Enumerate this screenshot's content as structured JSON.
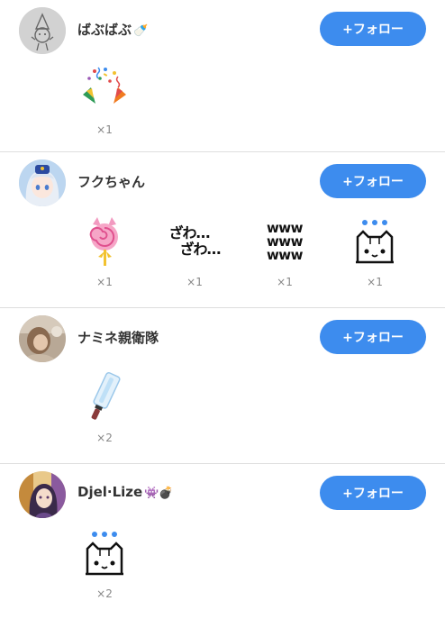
{
  "follow_label": "+フォロー",
  "users": [
    {
      "name": "ばぶばぶ",
      "name_emoji": "🍼",
      "avatar": "pencil-sketch-avatar",
      "gifts": [
        {
          "icon": "party-popper-icon",
          "count": "×1"
        }
      ]
    },
    {
      "name": "フクちゃん",
      "name_emoji": "",
      "avatar": "anime-girl-avatar",
      "gifts": [
        {
          "icon": "lollipop-icon",
          "count": "×1"
        },
        {
          "icon": "zawazawa-icon",
          "text": [
            "ざわ…",
            "ざわ…"
          ],
          "count": "×1"
        },
        {
          "icon": "www-icon",
          "text": [
            "www",
            "www",
            "www"
          ],
          "count": "×1"
        },
        {
          "icon": "cat-dots-icon",
          "count": "×1"
        }
      ]
    },
    {
      "name": "ナミネ親衛隊",
      "name_emoji": "",
      "avatar": "photo-avatar",
      "gifts": [
        {
          "icon": "glow-stick-icon",
          "count": "×2"
        }
      ]
    },
    {
      "name": "Djel·Lize",
      "name_emoji": "👾💣",
      "avatar": "illustrated-girl-avatar",
      "gifts": [
        {
          "icon": "cat-dots-icon",
          "count": "×2"
        }
      ]
    }
  ],
  "colors": {
    "follow_button": "#3d8cee",
    "divider": "#dedede",
    "count_text": "#888888",
    "dots": "#3d8cee"
  }
}
